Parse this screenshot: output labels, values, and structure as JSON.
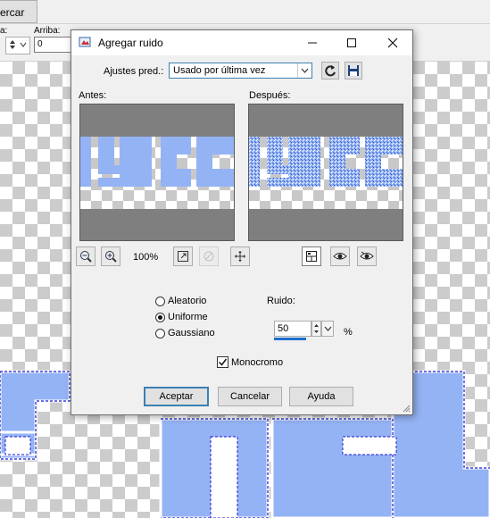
{
  "background_app": {
    "tab_label": "ercar",
    "toolbar": {
      "label_left": "a:",
      "label_arriba": "Arriba:",
      "arriba_value": "0"
    }
  },
  "dialog": {
    "title": "Agregar ruido",
    "app_icon": "paint-app-icon",
    "window_buttons": {
      "minimize": "minimize-icon",
      "maximize": "maximize-icon",
      "close": "close-icon"
    },
    "presets": {
      "label": "Ajustes pred.:",
      "selected": "Usado por última vez",
      "reset_icon": "reset-arrow-icon",
      "save_icon": "save-floppy-icon"
    },
    "before_label": "Antes:",
    "after_label": "Después:",
    "zoom_value": "100%",
    "colors": {
      "letter_fill": "#94b3f5",
      "preview_frame": "#7f7f7f",
      "accent": "#3c7fb1"
    },
    "noise": {
      "options": [
        "Aleatorio",
        "Uniforme",
        "Gaussiano"
      ],
      "selected": "Uniforme",
      "amount_label": "Ruido:",
      "amount_value": "50",
      "unit": "%",
      "slider_fraction": 0.5,
      "monochrome_label": "Monocromo",
      "monochrome_checked": true
    },
    "buttons": {
      "ok": "Aceptar",
      "cancel": "Cancelar",
      "help": "Ayuda"
    }
  }
}
